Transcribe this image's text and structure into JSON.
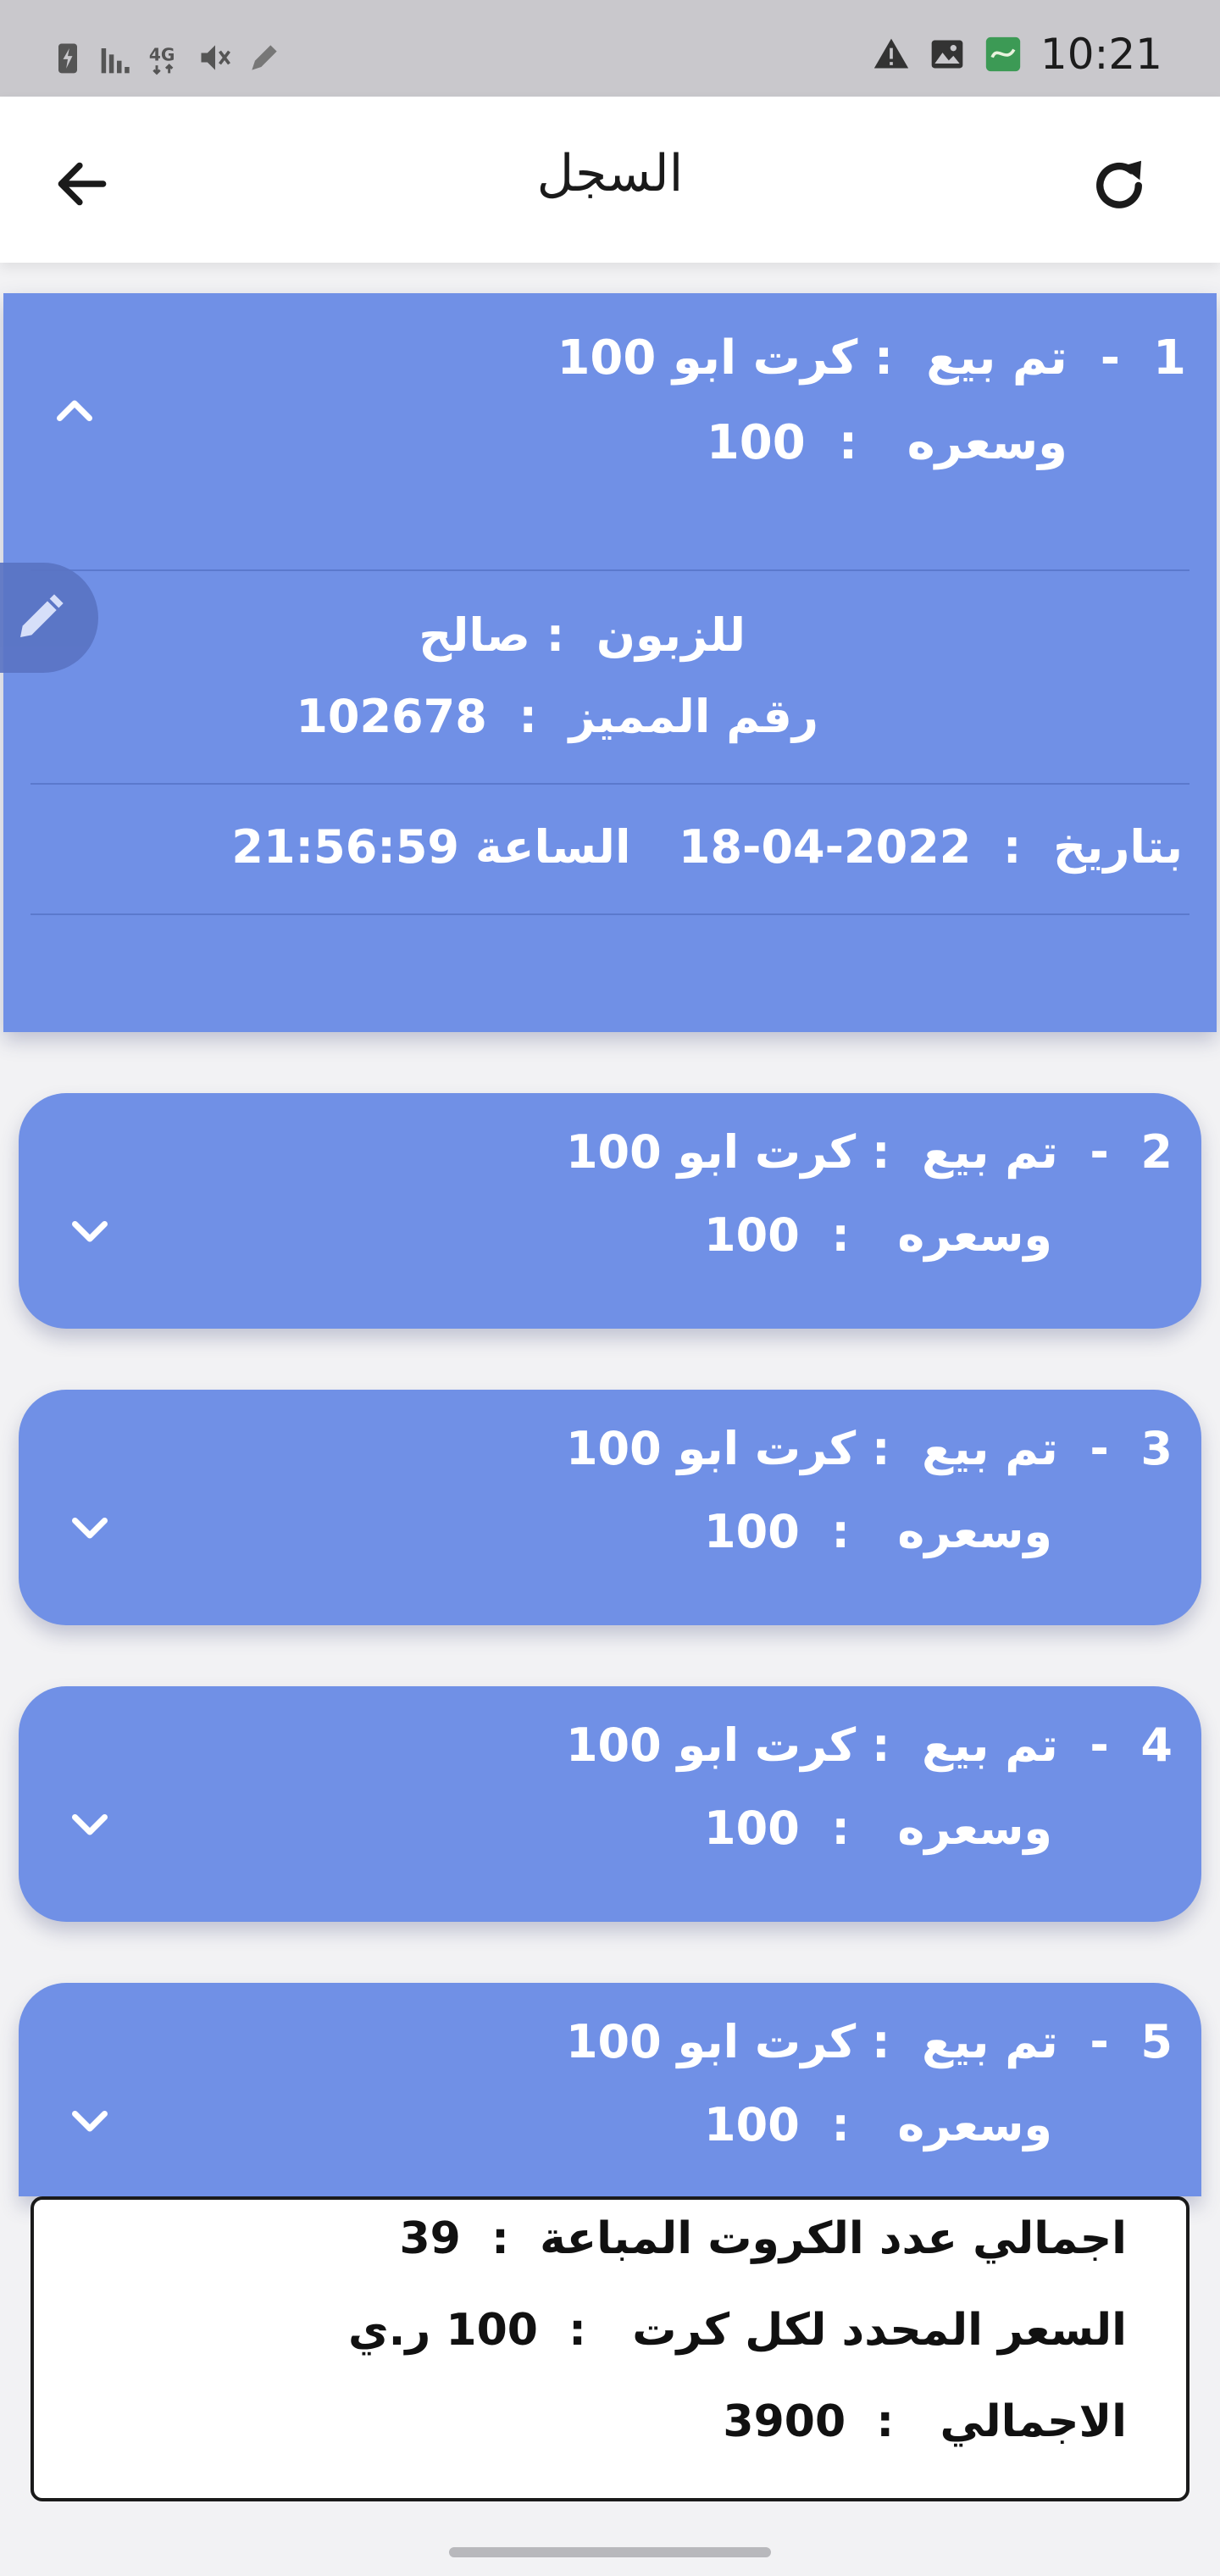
{
  "status_bar": {
    "time": "10:21",
    "left_icons": [
      "battery-charging-icon",
      "signal-icon",
      "lte-icon",
      "mute-icon",
      "pen-icon"
    ],
    "right_icons": [
      "warning-icon",
      "image-icon",
      "app-icon"
    ]
  },
  "app_bar": {
    "title": "السجل",
    "back_icon": "arrow-left-icon",
    "refresh_icon": "refresh-icon"
  },
  "records": [
    {
      "index": "1",
      "line1": "1  -  تم بيع  : كرت ابو 100",
      "line2": "وسعره   :  100",
      "expanded": true,
      "customer": "للزبون  : صالح",
      "code": "رقم المميز  :  102678",
      "datetime": "بتاريخ  :  2022-04-18   الساعة 21:56:59"
    },
    {
      "index": "2",
      "line1": "2  -  تم بيع  : كرت ابو 100",
      "line2": "وسعره   :  100",
      "expanded": false
    },
    {
      "index": "3",
      "line1": "3  -  تم بيع  : كرت ابو 100",
      "line2": "وسعره   :  100",
      "expanded": false
    },
    {
      "index": "4",
      "line1": "4  -  تم بيع  : كرت ابو 100",
      "line2": "وسعره   :  100",
      "expanded": false
    },
    {
      "index": "5",
      "line1": "5  -  تم بيع  : كرت ابو 100",
      "line2": "وسعره   :  100",
      "expanded": false
    }
  ],
  "summary": {
    "total_cards": "اجمالي عدد الكروت المباعة  :  39",
    "price_per_card": "السعر المحدد لكل كرت   :  100 ر.ي",
    "total": "الاجمالي   :  3900"
  },
  "colors": {
    "card": "#7090e6",
    "status_bar": "#c9c8cc",
    "background": "#f2f2f4"
  }
}
